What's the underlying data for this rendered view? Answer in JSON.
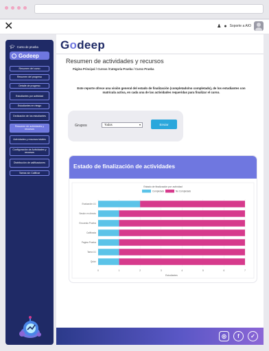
{
  "topbar": {
    "close_icon": "close-icon",
    "support_label": "Soporte a AIO",
    "bell_icon": "bell-icon",
    "chat_icon": "chat-icon"
  },
  "sidebar": {
    "course_link": "Curso de prueba",
    "logo_text": "Godeep",
    "items": [
      {
        "label": "Resumen del curso"
      },
      {
        "label": "Resumen del progreso"
      },
      {
        "label": "Detalle de progreso"
      },
      {
        "label": "Estudiantes por actividad"
      },
      {
        "label": "Estudiantes en riesgo"
      },
      {
        "label": "Dedicación de los estudiantes"
      },
      {
        "label": "Resumen de actividades y recursos"
      },
      {
        "label": "Actividades y recursos totales"
      },
      {
        "label": "Configuración de Actividades y recursos"
      },
      {
        "label": "Distribución de calificaciones"
      },
      {
        "label": "Tareas sin Calificar"
      }
    ],
    "active_index": 6
  },
  "main": {
    "brand_prefix": "G",
    "brand_o": "o",
    "brand_suffix": "deep",
    "page_title": "Resumen de actividades y recursos",
    "breadcrumb": "Página Principal / Cursos /Categoría Prueba / Curso Prueba",
    "description": "Este reporte ofrece una visión general del estado de finalización (completado/no completado), de los estudiantes con matrícula activa, en cada una de las actividades requeridas para finalizar el curso.",
    "filter": {
      "label": "Grupos",
      "selected": "Todos",
      "button": "Enviar"
    },
    "chart_card_title": "Estado de finalización de actividades"
  },
  "chart_data": {
    "type": "bar",
    "orientation": "horizontal",
    "stacked": true,
    "title": "Estado de finalización por actividad",
    "xlabel": "Estudiantes",
    "categories": [
      "Evaluación U1",
      "Sesión en directo",
      "Encuesta Prueba",
      "Calificada",
      "Pagina Prueba",
      "Tarea U1",
      "Quizz"
    ],
    "series": [
      {
        "name": "Completado",
        "color": "#5bc3e8",
        "values": [
          2,
          1,
          1,
          1,
          1,
          1,
          1
        ]
      },
      {
        "name": "No Completado",
        "color": "#d63a8c",
        "values": [
          5,
          6,
          6,
          6,
          6,
          6,
          6
        ]
      }
    ],
    "xlim": [
      0,
      7
    ],
    "xticks": [
      0,
      1,
      2,
      3,
      4,
      5,
      6,
      7
    ],
    "grid": true,
    "legend": "top"
  },
  "footer": {
    "social": [
      {
        "icon": "instagram-icon",
        "glyph": "◎"
      },
      {
        "icon": "facebook-icon",
        "glyph": "f"
      },
      {
        "icon": "twitter-icon",
        "glyph": "✓"
      }
    ]
  }
}
